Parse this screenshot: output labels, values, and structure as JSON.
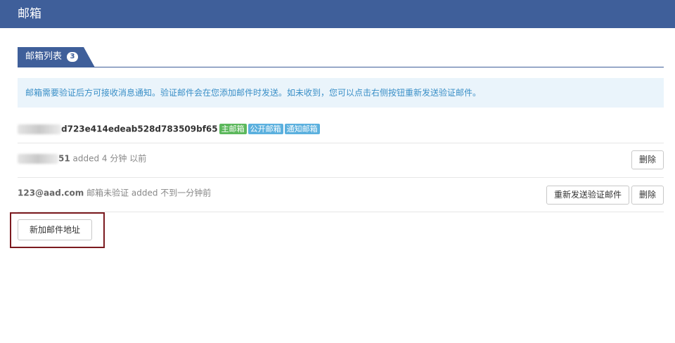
{
  "header": {
    "title": "邮箱"
  },
  "tab": {
    "label": "邮箱列表",
    "count": "3"
  },
  "notice": {
    "text": "邮箱需要验证后方可接收消息通知。验证邮件会在您添加邮件时发送。如未收到，您可以点击右侧按钮重新发送验证邮件。"
  },
  "emails": [
    {
      "address_visible": "d723e414edeab528d783509bf65",
      "badges": [
        {
          "label": "主邮箱",
          "color": "#5cb85c"
        },
        {
          "label": "公开邮箱",
          "color": "#5bb0de"
        },
        {
          "label": "通知邮箱",
          "color": "#5bb0de"
        }
      ]
    },
    {
      "address_visible": "51",
      "status": "added 4 分钟 以前",
      "delete_label": "删除"
    },
    {
      "address": "123@aad.com",
      "status": "邮箱未验证 added 不到一分钟前",
      "resend_label": "重新发送验证邮件",
      "delete_label": "删除"
    }
  ],
  "add_button": {
    "label": "新加邮件地址"
  },
  "colors": {
    "header": "#3f5f9a",
    "notice_bg": "#eaf4fb",
    "notice_text": "#3a8fc7",
    "highlight": "#7b1a1f"
  }
}
